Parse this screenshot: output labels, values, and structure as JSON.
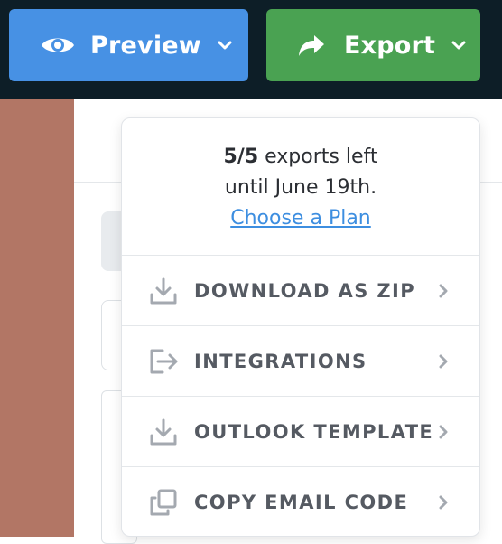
{
  "toolbar": {
    "preview_label": "Preview",
    "export_label": "Export",
    "preview_color": "#4791e4",
    "export_color": "#4aa252",
    "background_color": "#0d1e27"
  },
  "export_menu": {
    "quota_count": "5/5",
    "quota_text": "exports left",
    "quota_date": "until June 19th.",
    "choose_plan": "Choose a Plan",
    "items": [
      {
        "label": "DOWNLOAD AS ZIP",
        "icon": "download-icon"
      },
      {
        "label": "INTEGRATIONS",
        "icon": "integrations-icon"
      },
      {
        "label": "OUTLOOK TEMPLATE",
        "icon": "download-icon"
      },
      {
        "label": "COPY EMAIL CODE",
        "icon": "copy-icon"
      }
    ]
  }
}
